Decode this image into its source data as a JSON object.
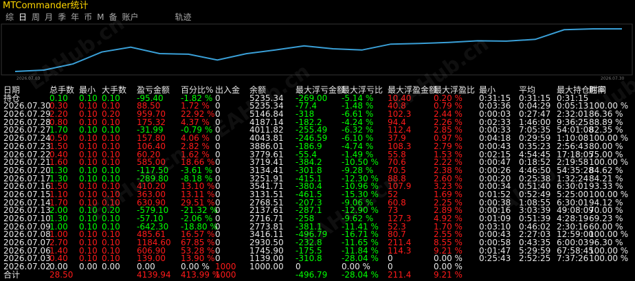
{
  "title": "MTCommander统计",
  "tabs": [
    "综",
    "日",
    "周",
    "月",
    "季",
    "年",
    "币",
    "M",
    "备",
    "账户",
    "轨迹"
  ],
  "selected_tab": "日",
  "chart": {
    "line_color": "#3aa0d8",
    "x_start_label": "2026.07.03",
    "x_end_label": "2026.07.30",
    "equity": [
      1000,
      1139,
      1745.9,
      2930.5,
      3416.11,
      2773.81,
      2716.71,
      2137.61,
      2768.51,
      3131.51,
      3541.71,
      3251.91,
      3134.41,
      3719.41,
      3779.61,
      3886.01,
      4043.81,
      4011.82,
      4187.14,
      5146.84,
      5235.34,
      5235.34
    ]
  },
  "headers": [
    "日期",
    "总手数",
    "最小",
    "大手数",
    "盈亏金额",
    "百分比%",
    "出入金",
    "余额",
    "最大浮亏金额",
    "最大浮亏比",
    "最大浮盈金额",
    "最大浮盈比",
    "最小",
    "平均",
    "最大持仓时间",
    "胜率"
  ],
  "holding_row": {
    "date": "持仓",
    "lots": "0.10",
    "min": "0.10",
    "max": "0.10",
    "pl": "-95.40",
    "pct": "-1.82 %",
    "io": "0",
    "bal": "5235.34",
    "fl": "-269.00",
    "flp": "-5.14 %",
    "fp": "10.40",
    "fpp": "0.20 %",
    "tmin": "0:31:15",
    "tavg": "0:31:15",
    "tmax": "0:31:15",
    "win": ""
  },
  "rows": [
    {
      "date": "2026.07.30",
      "lots": "0.30",
      "min": "0.10",
      "max": "0.10",
      "pl": "88.50",
      "pct": "1.72 %",
      "io": "0",
      "bal": "5235.34",
      "fl": "-77.4",
      "flp": "-1.48 %",
      "fp": "40.8",
      "fpp": "0.79 %",
      "tmin": "0:03:36",
      "tavg": "0:04:29",
      "tmax": "0:05:13",
      "win": "100.00 %"
    },
    {
      "date": "2026.07.29",
      "lots": "2.20",
      "min": "0.10",
      "max": "0.20",
      "pl": "959.70",
      "pct": "22.92 %",
      "io": "0",
      "bal": "5146.84",
      "fl": "-318",
      "flp": "-6.61 %",
      "fp": "102.3",
      "fpp": "2.44 %",
      "tmin": "0:00:03",
      "tavg": "0:27:47",
      "tmax": "2:32:01",
      "win": "86.36 %"
    },
    {
      "date": "2026.07.28",
      "lots": "0.80",
      "min": "0.10",
      "max": "0.10",
      "pl": "175.32",
      "pct": "4.37 %",
      "io": "0",
      "bal": "4187.14",
      "fl": "-182.2",
      "flp": "-4.24 %",
      "fp": "94.4",
      "fpp": "2.26 %",
      "tmin": "0:02:33",
      "tavg": "1:46:00",
      "tmax": "9:36:25",
      "win": "88.89 %"
    },
    {
      "date": "2026.07.27",
      "lots": "1.70",
      "min": "0.10",
      "max": "0.10",
      "pl": "-31.99",
      "pct": "-0.79 %",
      "io": "0",
      "bal": "4011.82",
      "fl": "-255.49",
      "flp": "-6.32 %",
      "fp": "112.4",
      "fpp": "2.85 %",
      "tmin": "0:00:33",
      "tavg": "7:05:35",
      "tmax": "54:01:08",
      "win": "82.35 %"
    },
    {
      "date": "2026.07.24",
      "lots": "0.50",
      "min": "0.10",
      "max": "0.10",
      "pl": "157.80",
      "pct": "4.06 %",
      "io": "0",
      "bal": "4043.81",
      "fl": "-246.59",
      "flp": "-6.10 %",
      "fp": "37.9",
      "fpp": "0.97 %",
      "tmin": "0:04:18",
      "tavg": "0:29:59",
      "tmax": "1:10:08",
      "win": "100.00 %"
    },
    {
      "date": "2026.07.23",
      "lots": "1.50",
      "min": "0.10",
      "max": "0.10",
      "pl": "106.40",
      "pct": "2.82 %",
      "io": "0",
      "bal": "3886.01",
      "fl": "-186.9",
      "flp": "-4.74 %",
      "fp": "108.3",
      "fpp": "2.79 %",
      "tmin": "0:00:43",
      "tavg": "0:35:23",
      "tmax": "2:56:43",
      "win": "80.00 %"
    },
    {
      "date": "2026.07.22",
      "lots": "0.40",
      "min": "0.10",
      "max": "0.10",
      "pl": "60.20",
      "pct": "1.62 %",
      "io": "0",
      "bal": "3779.61",
      "fl": "-55.4",
      "flp": "-1.49 %",
      "fp": "55.8",
      "fpp": "1.53 %",
      "tmin": "0:02:15",
      "tavg": "4:54:45",
      "tmax": "17:18:05",
      "win": "75.00 %"
    },
    {
      "date": "2026.07.21",
      "lots": "1.60",
      "min": "0.10",
      "max": "0.10",
      "pl": "585.00",
      "pct": "18.66 %",
      "io": "0",
      "bal": "3719.41",
      "fl": "-384.2",
      "flp": "-10.50 %",
      "fp": "70.6",
      "fpp": "2.22 %",
      "tmin": "0:00:47",
      "tavg": "0:18:52",
      "tmax": "2:19:58",
      "win": "100.00 %"
    },
    {
      "date": "2026.07.20",
      "lots": "1.30",
      "min": "0.10",
      "max": "0.10",
      "pl": "-117.50",
      "pct": "-3.61 %",
      "io": "0",
      "bal": "3134.41",
      "fl": "-301.8",
      "flp": "-9.28 %",
      "fp": "70.5",
      "fpp": "2.38 %",
      "tmin": "0:00:26",
      "tavg": "4:46:50",
      "tmax": "54:35:28",
      "win": "84.62 %"
    },
    {
      "date": "2026.07.17",
      "lots": "1.30",
      "min": "0.10",
      "max": "0.10",
      "pl": "-289.80",
      "pct": "-8.18 %",
      "io": "0",
      "bal": "3251.91",
      "fl": "-415.1",
      "flp": "-12.30 %",
      "fp": "88.8",
      "fpp": "2.60 %",
      "tmin": "0:00:20",
      "tavg": "0:25:38",
      "tmax": "1:32:24",
      "win": "84.21 %"
    },
    {
      "date": "2026.07.16",
      "lots": "1.50",
      "min": "0.10",
      "max": "0.10",
      "pl": "410.20",
      "pct": "13.10 %",
      "io": "0",
      "bal": "3541.71",
      "fl": "-380.4",
      "flp": "-10.96 %",
      "fp": "107.9",
      "fpp": "3.23 %",
      "tmin": "0:00:34",
      "tavg": "0:51:40",
      "tmax": "6:30:01",
      "win": "93.33 %"
    },
    {
      "date": "2026.07.15",
      "lots": "1.10",
      "min": "0.10",
      "max": "0.10",
      "pl": "363.00",
      "pct": "13.11 %",
      "io": "0",
      "bal": "3131.51",
      "fl": "-461.5",
      "flp": "-15.30 %",
      "fp": "52",
      "fpp": "1.69 %",
      "tmin": "0:01:52",
      "tavg": "0:52:49",
      "tmax": "5:25:00",
      "win": "100.00 %"
    },
    {
      "date": "2026.07.14",
      "lots": "1.70",
      "min": "0.10",
      "max": "0.10",
      "pl": "630.90",
      "pct": "29.51 %",
      "io": "0",
      "bal": "2768.51",
      "fl": "-207.3",
      "flp": "-9.06 %",
      "fp": "60.8",
      "fpp": "2.25 %",
      "tmin": "0:00:38",
      "tavg": "1:08:55",
      "tmax": "6:30:01",
      "win": "94.12 %"
    },
    {
      "date": "2026.07.13",
      "lots": "2.00",
      "min": "0.10",
      "max": "0.20",
      "pl": "-579.10",
      "pct": "-21.32 %",
      "io": "0",
      "bal": "2137.61",
      "fl": "-287.1",
      "flp": "-12.90 %",
      "fp": "73",
      "fpp": "2.89 %",
      "tmin": "0:00:16",
      "tavg": "3:03:39",
      "tmax": "49:08:09",
      "win": "70.00 %"
    },
    {
      "date": "2026.07.10",
      "lots": "1.30",
      "min": "0.10",
      "max": "0.10",
      "pl": "-57.10",
      "pct": "-2.06 %",
      "io": "0",
      "bal": "2716.71",
      "fl": "-258",
      "flp": "-9.62 %",
      "fp": "127.3",
      "fpp": "4.92 %",
      "tmin": "0:01:09",
      "tavg": "0:51:39",
      "tmax": "4:28:19",
      "win": "69.23 %"
    },
    {
      "date": "2026.07.09",
      "lots": "1.00",
      "min": "0.10",
      "max": "0.10",
      "pl": "-642.30",
      "pct": "-18.80 %",
      "io": "0",
      "bal": "2773.81",
      "fl": "-381.1",
      "flp": "-11.41 %",
      "fp": "52.3",
      "fpp": "1.70 %",
      "tmin": "0:03:10",
      "tavg": "0:46:02",
      "tmax": "2:30:16",
      "win": "60.00 %"
    },
    {
      "date": "2026.07.08",
      "lots": "1.00",
      "min": "0.10",
      "max": "0.10",
      "pl": "485.61",
      "pct": "16.57 %",
      "io": "0",
      "bal": "3416.11",
      "fl": "-496.79",
      "flp": "-16.71 %",
      "fp": "80.7",
      "fpp": "2.55 %",
      "tmin": "0:00:43",
      "tavg": "2:27:03",
      "tmax": "12:59:00",
      "win": "100.00 %"
    },
    {
      "date": "2026.07.07",
      "lots": "2.70",
      "min": "0.10",
      "max": "0.10",
      "pl": "1184.60",
      "pct": "67.85 %",
      "io": "0",
      "bal": "2930.50",
      "fl": "-232.8",
      "flp": "-11.65 %",
      "fp": "211.4",
      "fpp": "8.55 %",
      "tmin": "0:00:58",
      "tavg": "0:43:35",
      "tmax": "6:00:03",
      "win": "96.30 %"
    },
    {
      "date": "2026.07.06",
      "lots": "1.40",
      "min": "0.10",
      "max": "0.10",
      "pl": "606.90",
      "pct": "53.28 %",
      "io": "0",
      "bal": "1745.90",
      "fl": "-175.5",
      "flp": "-11.84 %",
      "fp": "114.3",
      "fpp": "9.21 %",
      "tmin": "0:01:47",
      "tavg": "5:29:59",
      "tmax": "67:58:45",
      "win": "100.00 %"
    },
    {
      "date": "2026.07.03",
      "lots": "0.40",
      "min": "0.10",
      "max": "0.10",
      "pl": "139.00",
      "pct": "13.90 %",
      "io": "0",
      "bal": "1139.00",
      "fl": "-310.8",
      "flp": "-28.04 %",
      "fp": "0",
      "fpp": "0.00 %",
      "tmin": "0:25:43",
      "tavg": "2:52:25",
      "tmax": "7:37:26",
      "win": "100.00 %"
    },
    {
      "date": "2026.07.02",
      "lots": "0.00",
      "min": "0.00",
      "max": "0.00",
      "pl": "0.00",
      "pct": "0.00 %",
      "io": "1000",
      "bal": "1000.00",
      "fl": "0",
      "flp": "0.00 %",
      "fp": "0",
      "fpp": "0.00 %",
      "tmin": "",
      "tavg": "",
      "tmax": "",
      "win": ""
    }
  ],
  "total_row": {
    "date": "合计",
    "lots": "28.50",
    "min": "",
    "max": "",
    "pl": "4139.94",
    "pct": "413.99 %",
    "io": "1000",
    "bal": "",
    "fl": "-496.79",
    "flp": "-28.04 %",
    "fp": "211.4",
    "fpp": "9.21 %",
    "tmin": "",
    "tavg": "",
    "tmax": "",
    "win": ""
  },
  "watermark": "EAHub.cn",
  "colors": {
    "title": "#ffd700",
    "positive": "#ff1a1a",
    "negative": "#00ff00",
    "neutral": "#e8e8e8",
    "background": "#000000"
  }
}
